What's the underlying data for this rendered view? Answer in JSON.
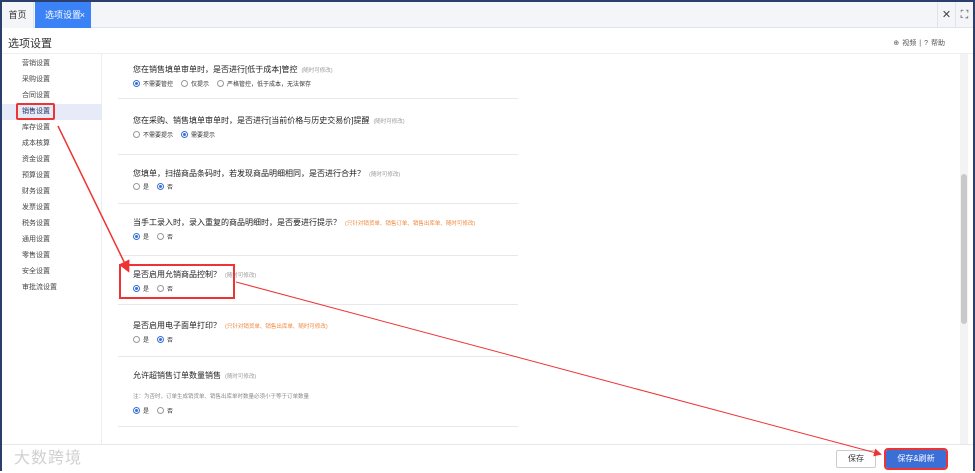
{
  "tabs": {
    "home": "首页",
    "active": "选项设置",
    "close": "×"
  },
  "window": {
    "close": "✕",
    "expand": "⛶"
  },
  "header": {
    "title": "选项设置",
    "video": "视频",
    "sep": "|",
    "help": "帮助"
  },
  "sidebar": {
    "items": [
      "营销设置",
      "采购设置",
      "合同设置",
      "销售设置",
      "库存设置",
      "成本核算",
      "资金设置",
      "预算设置",
      "财务设置",
      "发票设置",
      "税务设置",
      "通用设置",
      "零售设置",
      "安全设置",
      "审批流设置"
    ],
    "active_index": 3
  },
  "sections": [
    {
      "question": "您在销售填单审单时，是否进行[低于成本]管控",
      "hint": "(随时可修改)",
      "options": [
        "不需要管控",
        "仅提示",
        "严格管控，低于成本，无法保存"
      ],
      "selected": 0
    },
    {
      "question": "您在采购、销售填单审单时，是否进行[当前价格与历史交易价]提醒",
      "hint": "(随时可修改)",
      "options": [
        "不需要提示",
        "需要提示"
      ],
      "selected": 1
    },
    {
      "question": "您填单，扫描商品条码时，若发现商品明细相同，是否进行合并？",
      "hint": "(随时可修改)",
      "options": [
        "是",
        "否"
      ],
      "selected": 1
    },
    {
      "question": "当手工录入时，录入重复的商品明细时，是否要进行提示？",
      "hint_orange": "(只针对销货单、销售订单、销售出库单、随时可修改)",
      "options": [
        "是",
        "否"
      ],
      "selected": 0
    },
    {
      "question": "是否启用允销商品控制？",
      "hint": "(随时可修改)",
      "options": [
        "是",
        "否"
      ],
      "selected": 0
    },
    {
      "question": "是否启用电子面单打印？",
      "hint_orange": "(只针对销货单、销售出库单、随时可修改)",
      "options": [
        "是",
        "否"
      ],
      "selected": 1
    },
    {
      "question": "允许超销售订单数量销售",
      "hint": "(随时可修改)",
      "note": "注：为否时，订单生成销货单、销售出库单时数量必须小于等于订单数量",
      "options": [
        "是",
        "否"
      ],
      "selected": 0
    }
  ],
  "footer": {
    "save": "保存",
    "save_refresh": "保存&刷新"
  },
  "watermark": "大数跨境",
  "colors": {
    "accent": "#3b6fd6",
    "highlight": "#e33",
    "tab_active": "#3b82f6"
  }
}
